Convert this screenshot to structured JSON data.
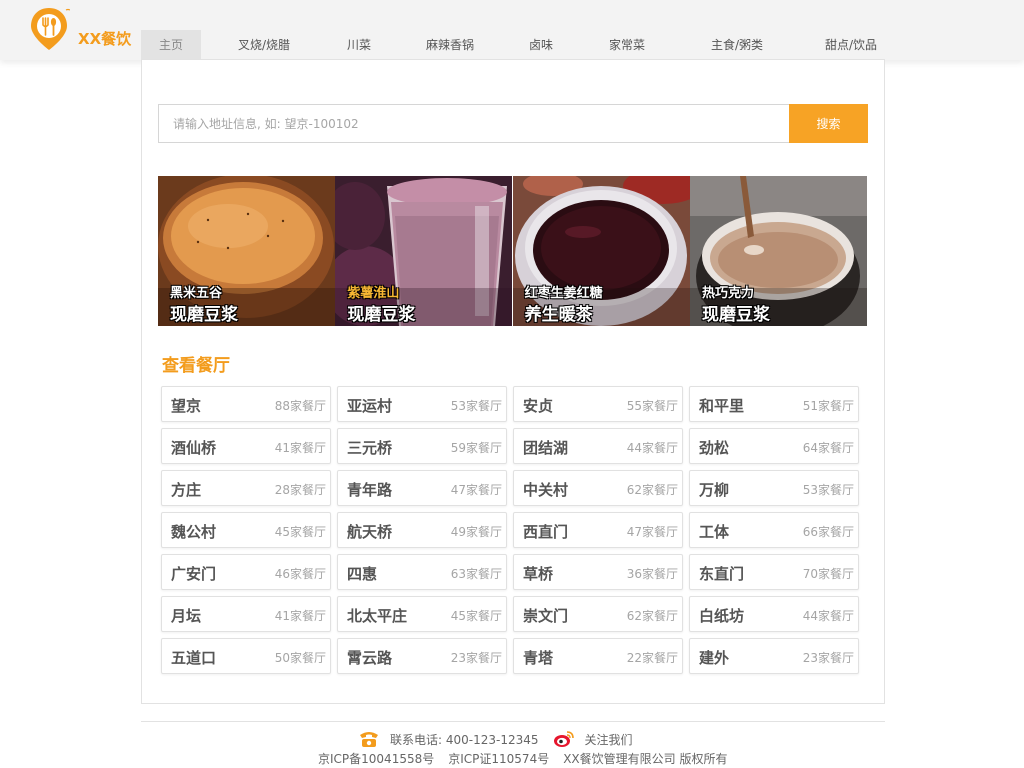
{
  "brand": {
    "name": "XX餐饮"
  },
  "nav": [
    {
      "label": "主页",
      "active": true,
      "width": 60
    },
    {
      "label": "叉烧/烧腊",
      "active": false,
      "width": 126
    },
    {
      "label": "川菜",
      "active": false,
      "width": 64
    },
    {
      "label": "麻辣香锅",
      "active": false,
      "width": 118
    },
    {
      "label": "卤味",
      "active": false,
      "width": 64
    },
    {
      "label": "家常菜",
      "active": false,
      "width": 108
    },
    {
      "label": "主食/粥类",
      "active": false,
      "width": 112
    },
    {
      "label": "甜点/饮品",
      "active": false,
      "width": 116
    }
  ],
  "search": {
    "placeholder": "请输入地址信息, 如: 望京-100102",
    "button": "搜索"
  },
  "banners": [
    {
      "small": "黑米五谷",
      "big": "现磨豆浆"
    },
    {
      "small": "紫薯淮山",
      "big": "现磨豆浆"
    },
    {
      "small": "红枣生姜红糖",
      "big": "养生暖茶"
    },
    {
      "small": "热巧克力",
      "big": "现磨豆浆"
    }
  ],
  "section": {
    "title": "查看餐厅"
  },
  "areas": [
    {
      "name": "望京",
      "count": "88家餐厅"
    },
    {
      "name": "亚运村",
      "count": "53家餐厅"
    },
    {
      "name": "安贞",
      "count": "55家餐厅"
    },
    {
      "name": "和平里",
      "count": "51家餐厅"
    },
    {
      "name": "酒仙桥",
      "count": "41家餐厅"
    },
    {
      "name": "三元桥",
      "count": "59家餐厅"
    },
    {
      "name": "团结湖",
      "count": "44家餐厅"
    },
    {
      "name": "劲松",
      "count": "64家餐厅"
    },
    {
      "name": "方庄",
      "count": "28家餐厅"
    },
    {
      "name": "青年路",
      "count": "47家餐厅"
    },
    {
      "name": "中关村",
      "count": "62家餐厅"
    },
    {
      "name": "万柳",
      "count": "53家餐厅"
    },
    {
      "name": "魏公村",
      "count": "45家餐厅"
    },
    {
      "name": "航天桥",
      "count": "49家餐厅"
    },
    {
      "name": "西直门",
      "count": "47家餐厅"
    },
    {
      "name": "工体",
      "count": "66家餐厅"
    },
    {
      "name": "广安门",
      "count": "46家餐厅"
    },
    {
      "name": "四惠",
      "count": "63家餐厅"
    },
    {
      "name": "草桥",
      "count": "36家餐厅"
    },
    {
      "name": "东直门",
      "count": "70家餐厅"
    },
    {
      "name": "月坛",
      "count": "41家餐厅"
    },
    {
      "name": "北太平庄",
      "count": "45家餐厅"
    },
    {
      "name": "崇文门",
      "count": "62家餐厅"
    },
    {
      "name": "白纸坊",
      "count": "44家餐厅"
    },
    {
      "name": "五道口",
      "count": "50家餐厅"
    },
    {
      "name": "霄云路",
      "count": "23家餐厅"
    },
    {
      "name": "青塔",
      "count": "22家餐厅"
    },
    {
      "name": "建外",
      "count": "23家餐厅"
    }
  ],
  "footer": {
    "phone": "联系电话: 400-123-12345",
    "follow": "关注我们",
    "icp1": "京ICP备10041558号",
    "icp2": "京ICP证110574号",
    "copyright": "XX餐饮管理有限公司 版权所有"
  },
  "colors": {
    "accent": "#f7a325",
    "brand": "#f39c1d"
  },
  "icons": {
    "logo": "fork-spoon-pin-icon",
    "phone": "phone-icon",
    "weibo": "weibo-icon"
  }
}
